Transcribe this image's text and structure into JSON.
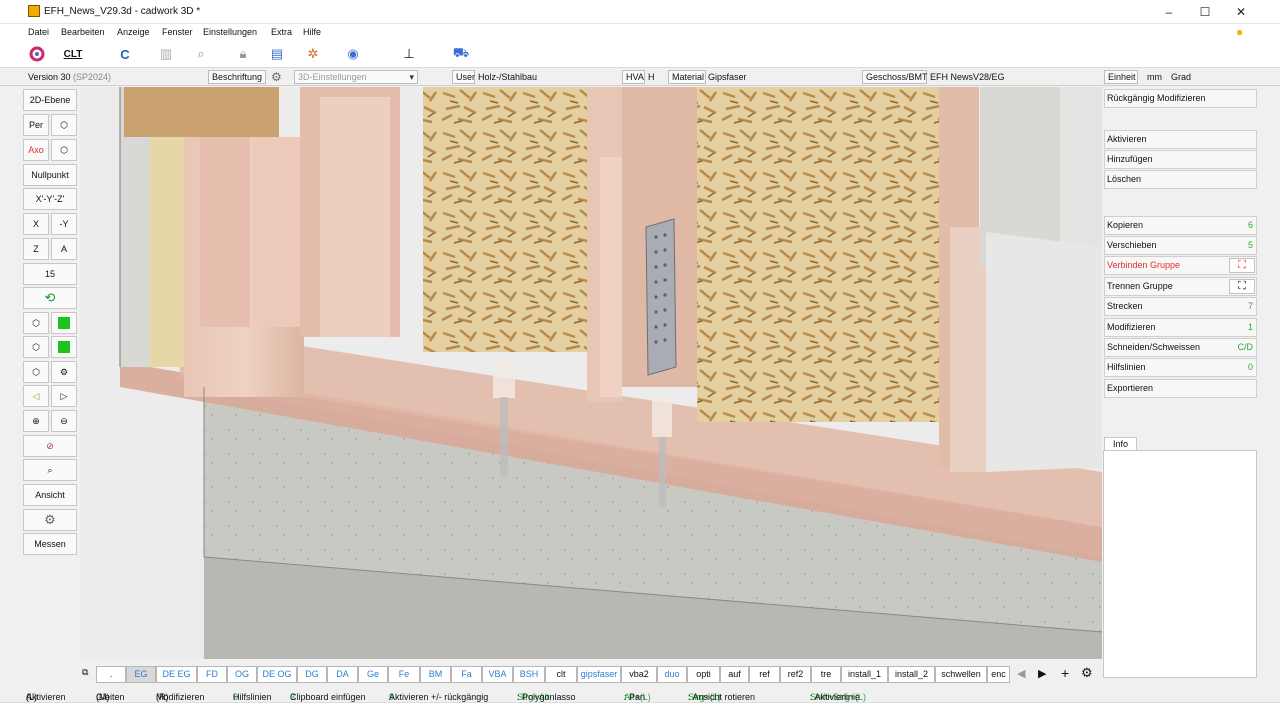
{
  "window": {
    "title": "EFH_News_V29.3d - cadwork 3D *"
  },
  "menu": [
    "Datei",
    "Bearbeiten",
    "Anzeige",
    "Fenster",
    "Einstellungen",
    "Extra",
    "Hilfe"
  ],
  "toolbar": {
    "clt_label": "CLT",
    "c_label": "C"
  },
  "status": {
    "version": "Version 30",
    "version_sp": "(SP2024)",
    "beschriftung": "Beschriftung",
    "settings3d": "3D-Einstellungen",
    "user_label": "User",
    "user_value": "Holz-/Stahlbau",
    "hva_label": "HVA",
    "hva_value": "H",
    "material_label": "Material",
    "material_value": "Gipsfaser",
    "geschoss_label": "Geschoss/BMT",
    "geschoss_value": "EFH NewsV28/EG",
    "einheit_label": "Einheit",
    "einheit_length": "mm",
    "einheit_angle": "Grad"
  },
  "left": {
    "ebene2d": "2D-Ebene",
    "per": "Per",
    "axo": "Axo",
    "nullpunkt": "Nullpunkt",
    "xyz": "X'-Y'-Z'",
    "x": "X",
    "my": "-Y",
    "z": "Z",
    "a": "A",
    "num15": "15",
    "ansicht": "Ansicht",
    "messen": "Messen"
  },
  "right": {
    "undo": "Rückgängig Modifizieren",
    "items": [
      {
        "label": "Aktivieren",
        "key": ""
      },
      {
        "label": "Hinzufügen",
        "key": ""
      },
      {
        "label": "Löschen",
        "key": ""
      },
      {
        "label": "Kopieren",
        "key": "6"
      },
      {
        "label": "Verschieben",
        "key": "5"
      },
      {
        "label": "Verbinden Gruppe",
        "key": ""
      },
      {
        "label": "Trennen Gruppe",
        "key": ""
      },
      {
        "label": "Strecken",
        "key": "7"
      },
      {
        "label": "Modifizieren",
        "key": "1"
      },
      {
        "label": "Schneiden/Schweissen",
        "key": "C/D"
      },
      {
        "label": "Hilfslinien",
        "key": "0"
      },
      {
        "label": "Exportieren",
        "key": ""
      }
    ],
    "info_tab": "Info",
    "accent_red": "#e0302a",
    "accent_green": "#2aa838"
  },
  "tabs": [
    ".",
    "EG",
    "DE EG",
    "FD",
    "OG",
    "DE OG",
    "DG",
    "DA",
    "Ge",
    "Fe",
    "BM",
    "Fa",
    "VBA",
    "BSH",
    "clt",
    "gipsfaser",
    "vba2",
    "duo",
    "opti",
    "auf",
    "ref",
    "ref2",
    "tre",
    "install_1",
    "install_2",
    "schwellen",
    "enc"
  ],
  "hints": [
    {
      "k": "(L)",
      "t": " Aktivieren"
    },
    {
      "k": "(M)",
      "t": " Gleiten"
    },
    {
      "k": "(R)",
      "t": " Modifizieren"
    },
    {
      "k": "0",
      "t": " Hilfslinien"
    },
    {
      "k": "3",
      "t": " Clipboard einfügen"
    },
    {
      "k": "9",
      "t": " Aktivieren +/- rückgängig"
    },
    {
      "k": "Strg+Alt",
      "t": ": Polygonlasso"
    },
    {
      "k": "Alt+(L)",
      "t": ": Pan"
    },
    {
      "k": "Strg+(L)",
      "t": ": Ansicht rotieren"
    },
    {
      "k": "Shift+Strg+(L)",
      "t": ": Aktivierlinie"
    }
  ]
}
